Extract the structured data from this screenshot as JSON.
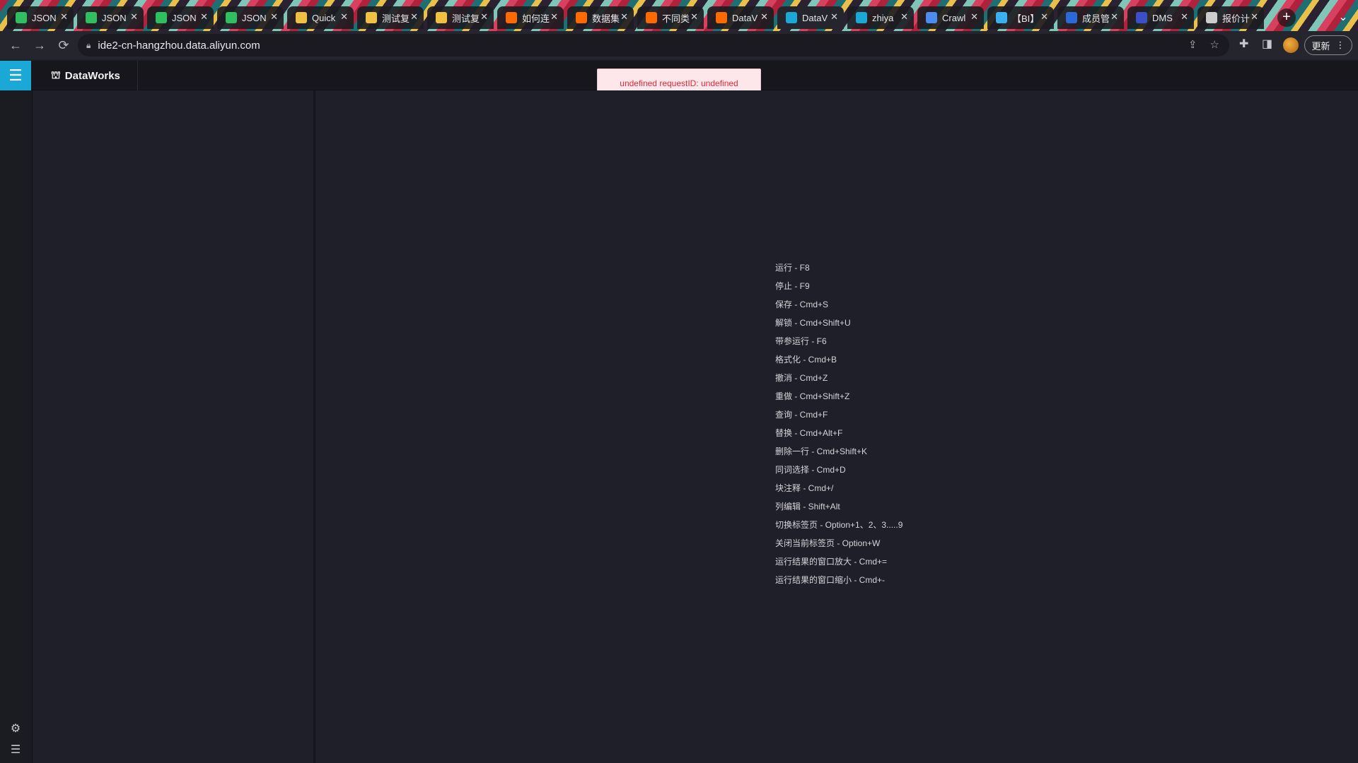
{
  "browser": {
    "tabs": [
      {
        "title": "JSON",
        "fav_color": "#2fbf5f",
        "fav": ""
      },
      {
        "title": "JSON",
        "fav_color": "#2fbf5f",
        "fav": ""
      },
      {
        "title": "JSON",
        "fav_color": "#2fbf5f",
        "fav": ""
      },
      {
        "title": "JSON",
        "fav_color": "#2fbf5f",
        "fav": ""
      },
      {
        "title": "Quick",
        "fav_color": "#f0c040",
        "fav": ""
      },
      {
        "title": "测试复",
        "fav_color": "#f0c040",
        "fav": ""
      },
      {
        "title": "测试复",
        "fav_color": "#f0c040",
        "fav": ""
      },
      {
        "title": "如何连",
        "fav_color": "#ff6a00",
        "fav": ""
      },
      {
        "title": "数据集",
        "fav_color": "#ff6a00",
        "fav": ""
      },
      {
        "title": "不同类",
        "fav_color": "#ff6a00",
        "fav": ""
      },
      {
        "title": "DataV",
        "fav_color": "#ff6a00",
        "fav": ""
      },
      {
        "title": "DataV",
        "fav_color": "#1aa8d6",
        "fav": ""
      },
      {
        "title": "zhiya",
        "fav_color": "#1aa8d6",
        "fav": ""
      },
      {
        "title": "Crawl",
        "fav_color": "#4a8cf0",
        "fav": ""
      },
      {
        "title": "【BI】",
        "fav_color": "#3bb0f0",
        "fav": ""
      },
      {
        "title": "成员管",
        "fav_color": "#2a6ad8",
        "fav": ""
      },
      {
        "title": "DMS",
        "fav_color": "#3a50c8",
        "fav": ""
      },
      {
        "title": "报价计",
        "fav_color": "#cccccc",
        "fav": ""
      }
    ],
    "active_tab_index": 11,
    "url": "ide2-cn-hangzhou.data.aliyun.com",
    "update_label": "更新"
  },
  "app": {
    "brand": "DataWorks",
    "toast": "undefined requestID: undefined",
    "shortcuts": [
      "运行 - F8",
      "停止 - F9",
      "保存 - Cmd+S",
      "解锁 - Cmd+Shift+U",
      "带参运行 - F6",
      "格式化 - Cmd+B",
      "撤消 - Cmd+Z",
      "重做 - Cmd+Shift+Z",
      "查询 - Cmd+F",
      "替换 - Cmd+Alt+F",
      "删除一行 - Cmd+Shift+K",
      "同词选择 - Cmd+D",
      "块注释 - Cmd+/",
      "列编辑 - Shift+Alt",
      "切换标签页 - Option+1、2、3.....9",
      "关闭当前标签页 - Option+W",
      "运行结果的窗口放大 - Cmd+=",
      "运行结果的窗口缩小 - Cmd+-"
    ]
  }
}
